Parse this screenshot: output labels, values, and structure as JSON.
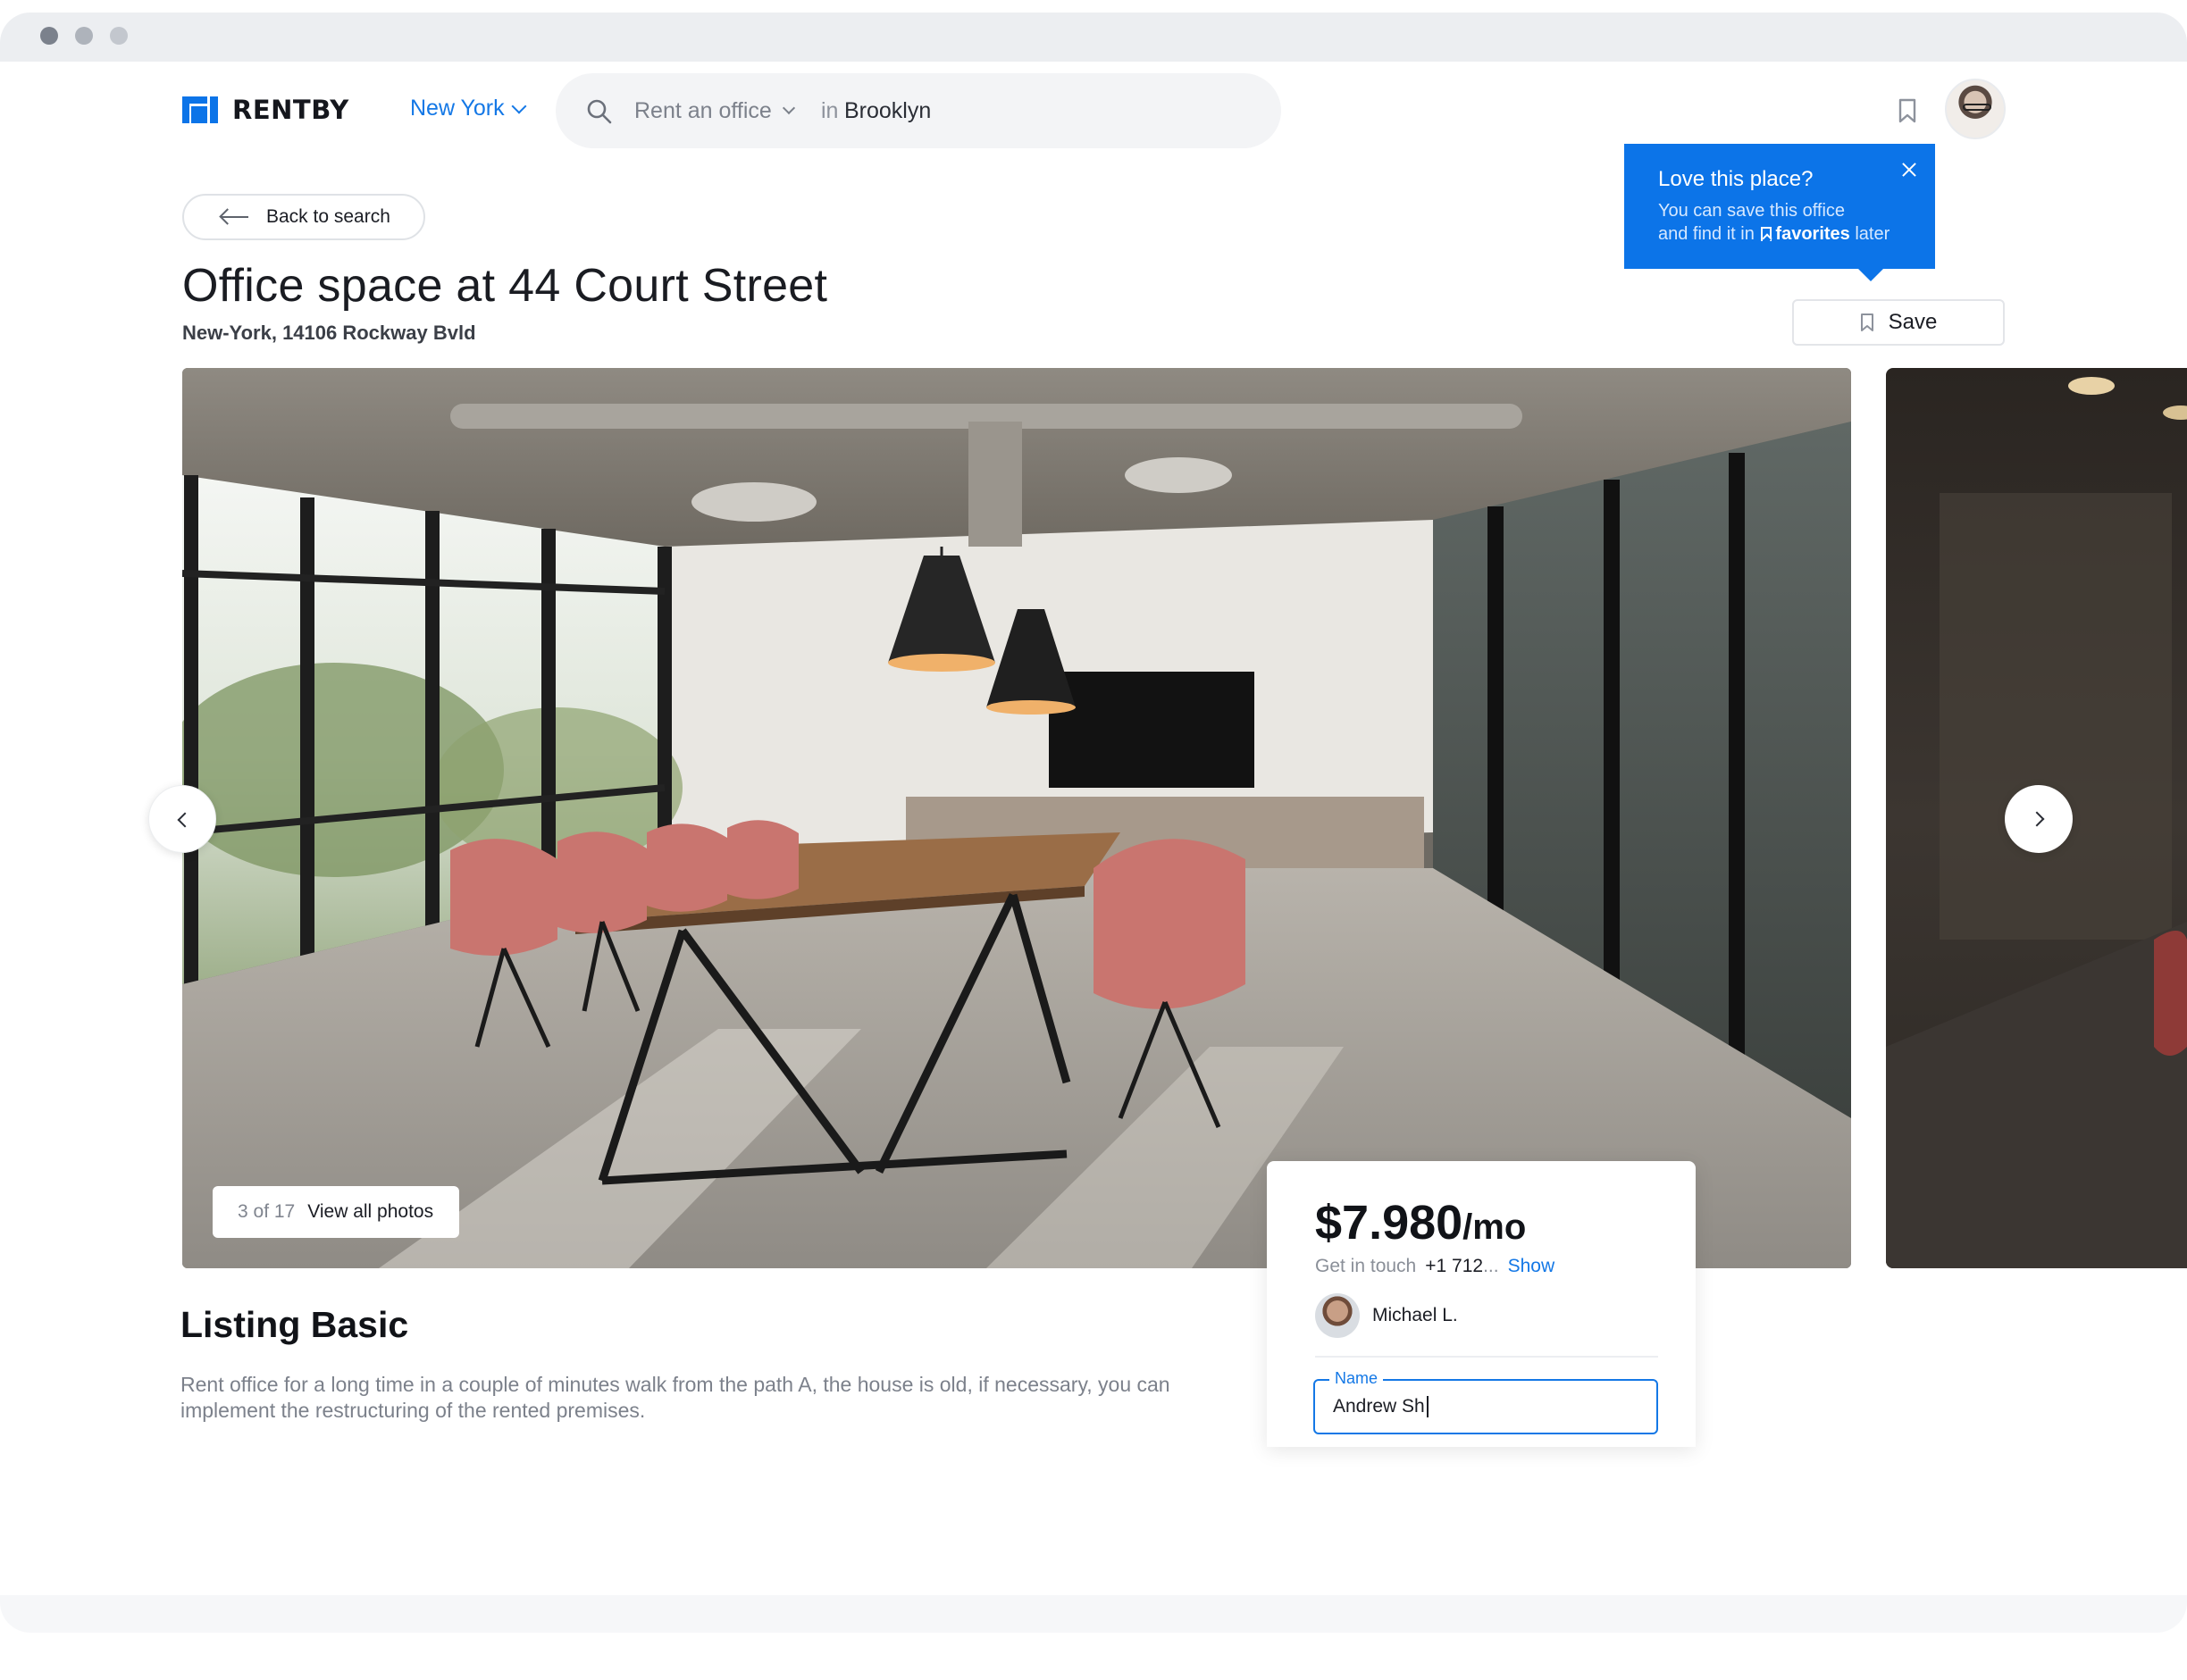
{
  "brand": {
    "name": "RENTBY",
    "accent": "#0c74e8"
  },
  "header": {
    "city": "New York",
    "search": {
      "type": "Rent an office",
      "in_label": "in",
      "location": "Brooklyn"
    }
  },
  "tooltip": {
    "title": "Love this place?",
    "line1": "You can save this office",
    "line2_prefix": "and find it in",
    "favorites": "favorites",
    "line2_suffix": "later"
  },
  "page": {
    "back_label": "Back to search",
    "title": "Office space at 44 Court Street",
    "address": "New-York, 14106 Rockway Bvld",
    "save_label": "Save"
  },
  "gallery": {
    "counter": "3 of 17",
    "view_all": "View all photos"
  },
  "price_card": {
    "price": "$7.980",
    "period": "/mo",
    "contact_label": "Get in touch",
    "phone": "+1 712",
    "ellipsis": "...",
    "show_label": "Show",
    "agent_name": "Michael L.",
    "name_field_label": "Name",
    "name_field_value": "Andrew Sh"
  },
  "listing": {
    "title": "Listing Basic",
    "description": "Rent office for a long time in a couple of minutes walk from the path A, the house is old, if necessary, you can implement the restructuring of the rented premises."
  }
}
